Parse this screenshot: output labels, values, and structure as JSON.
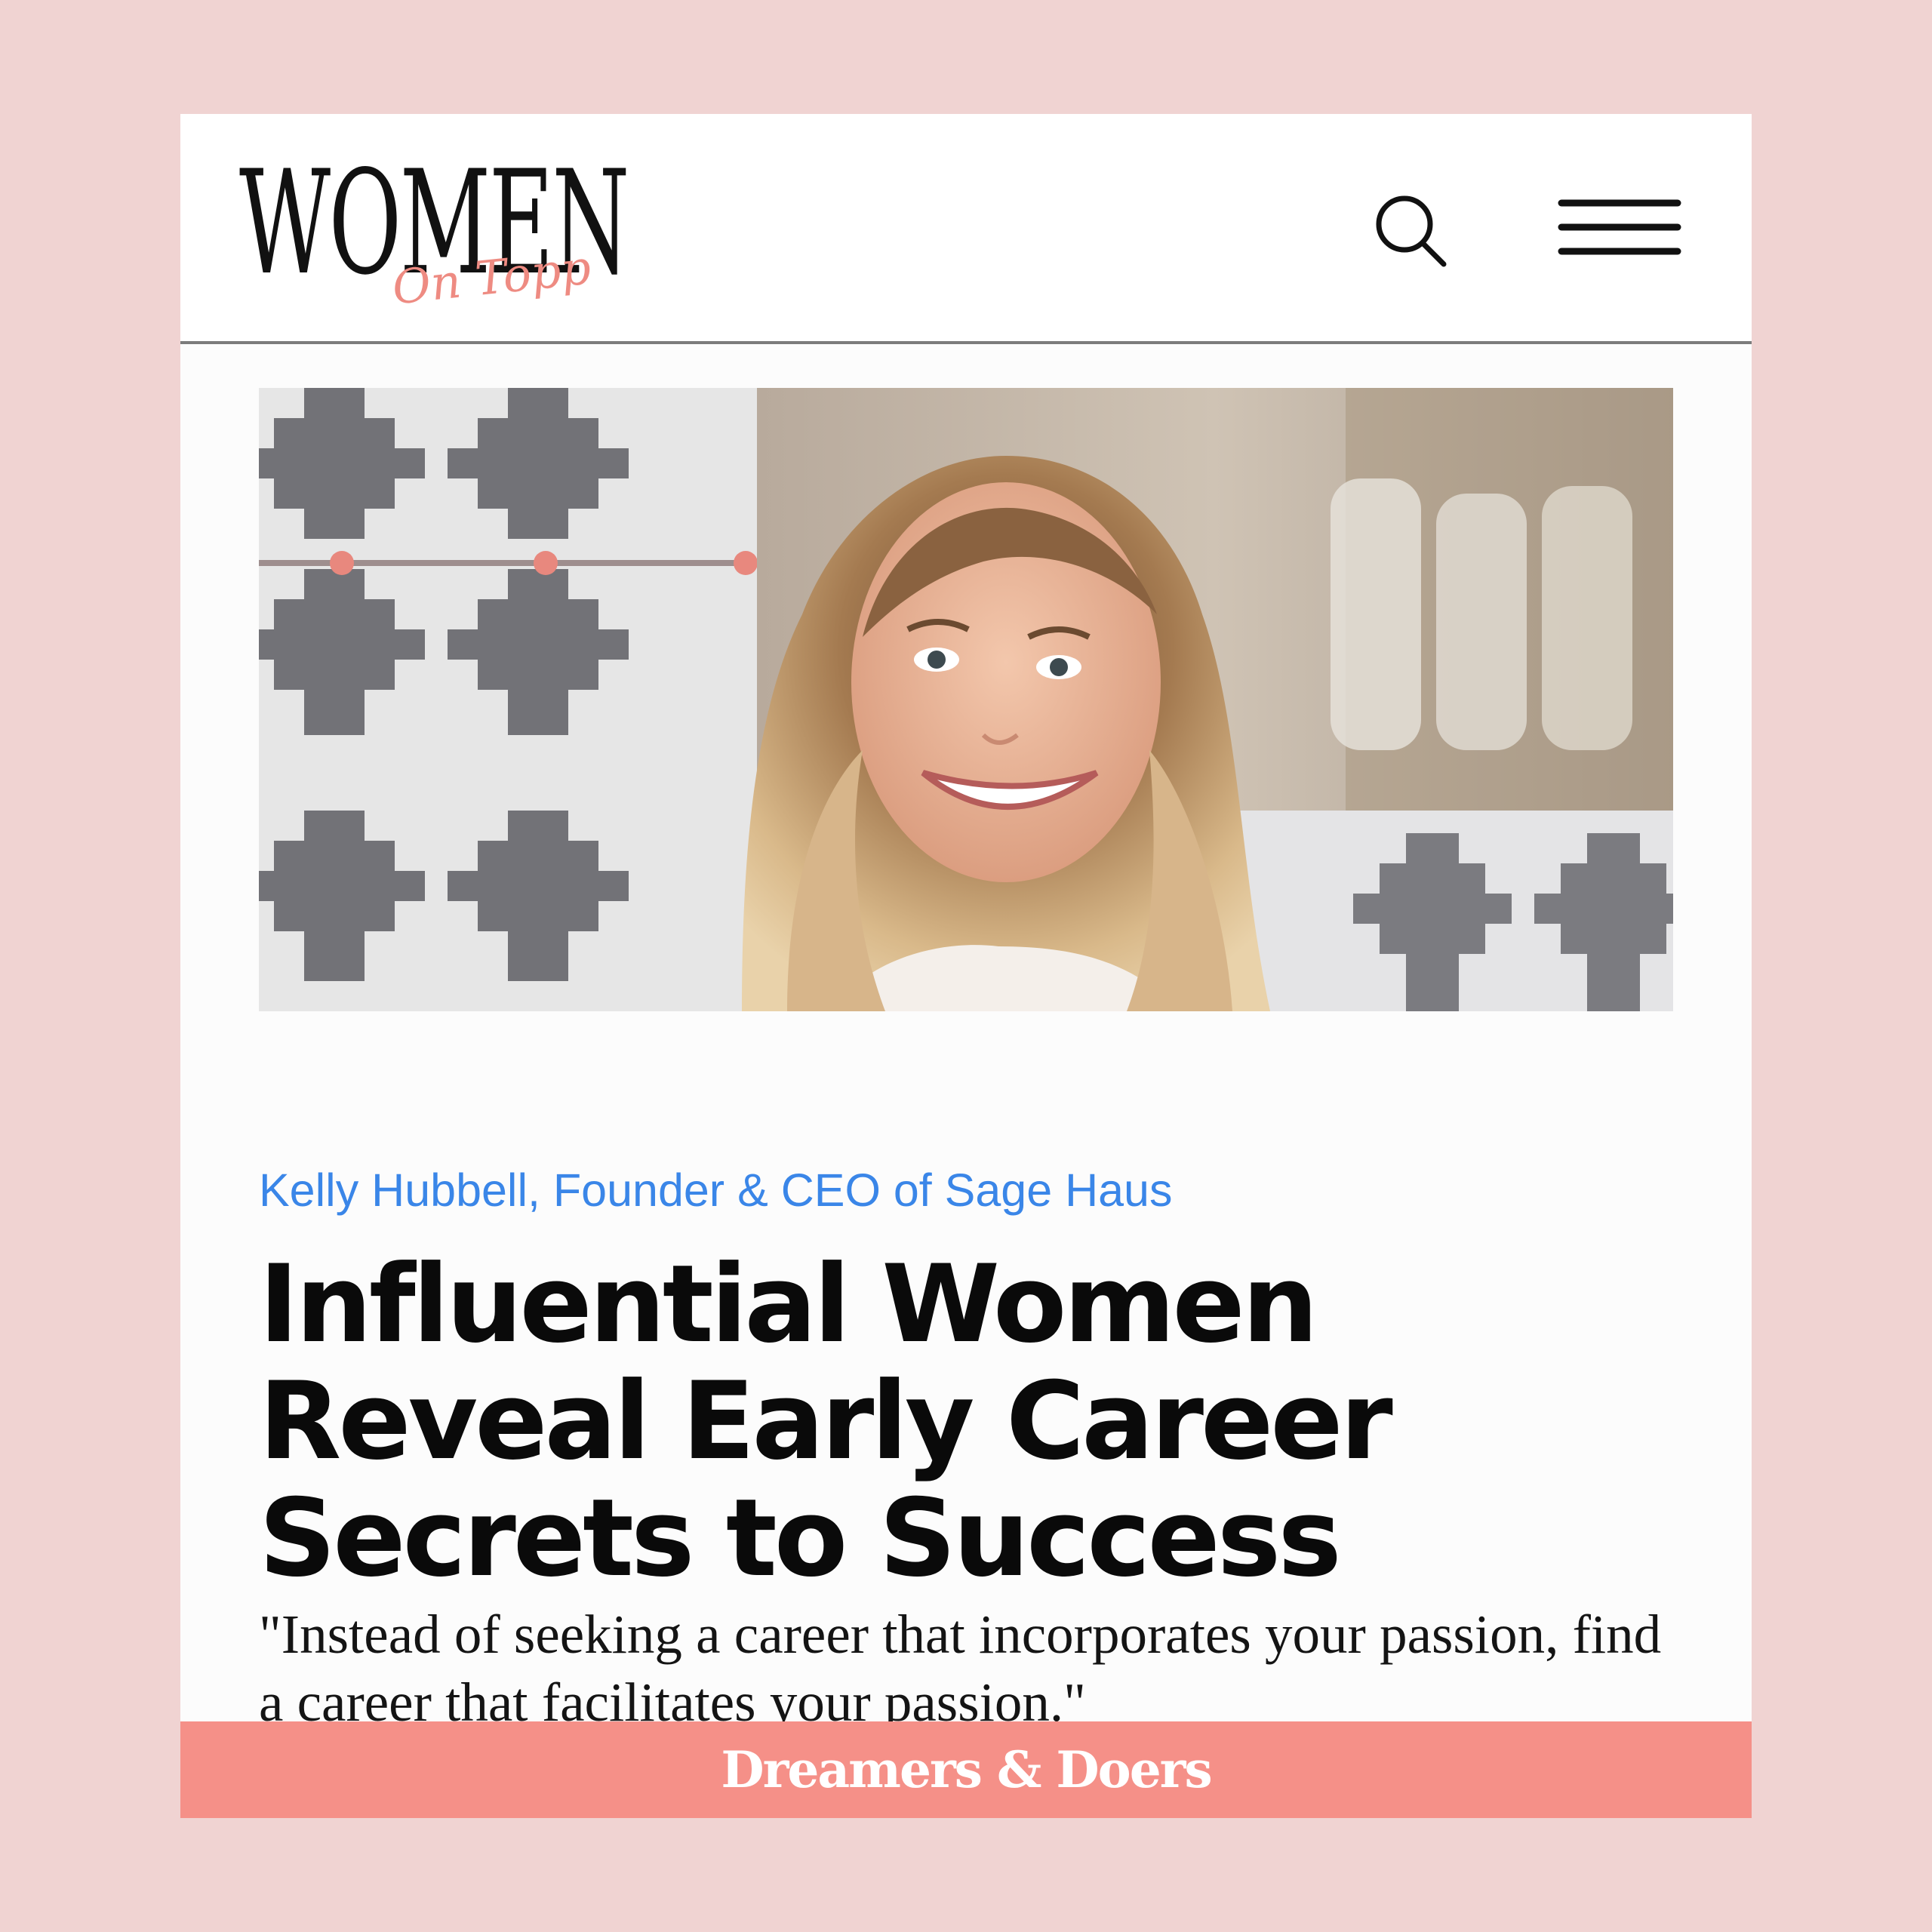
{
  "colors": {
    "page_background": "#f0d3d2",
    "card_background": "#fcfcfc",
    "logo_accent": "#ee8b82",
    "byline_link": "#3a86e8",
    "footer_band": "#f59088"
  },
  "header": {
    "logo_main": "WOMEN",
    "logo_script": "On Topp",
    "icons": [
      "search-icon",
      "hamburger-menu-icon"
    ]
  },
  "article": {
    "byline": "Kelly Hubbell, Founder & CEO of Sage Haus",
    "headline": "Influential Women Reveal Early Career Secrets to Success",
    "quote": "\"Instead of seeking a career that incorporates your passion, find a career that facilitates your passion.\""
  },
  "footer": {
    "band_text": "Dreamers & Doers"
  }
}
